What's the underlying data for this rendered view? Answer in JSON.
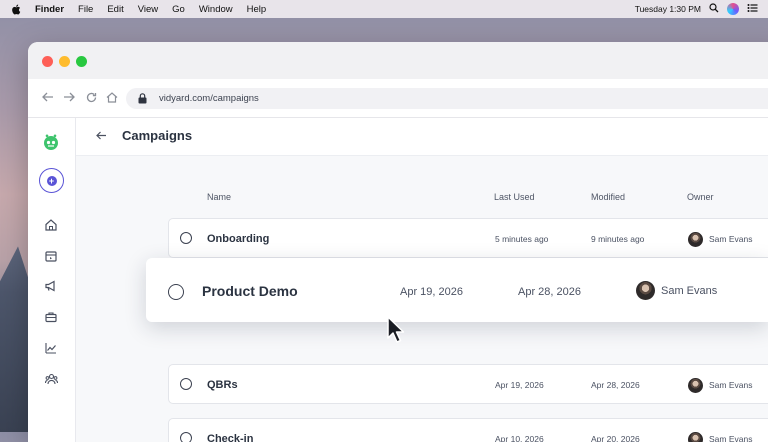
{
  "menubar": {
    "app": "Finder",
    "items": [
      "File",
      "Edit",
      "View",
      "Go",
      "Window",
      "Help"
    ],
    "clock": "Tuesday 1:30 PM"
  },
  "browser": {
    "url": "vidyard.com/campaigns"
  },
  "page": {
    "title": "Campaigns"
  },
  "table": {
    "columns": {
      "name": "Name",
      "last_used": "Last Used",
      "modified": "Modified",
      "owner": "Owner"
    },
    "rows": [
      {
        "name": "Onboarding",
        "last_used": "5 minutes ago",
        "modified": "9 minutes ago",
        "owner": "Sam Evans"
      },
      {
        "name": "QBRs",
        "last_used": "Apr 19, 2026",
        "modified": "Apr 28, 2026",
        "owner": "Sam Evans"
      },
      {
        "name": "Check-in",
        "last_used": "Apr 10, 2026",
        "modified": "Apr 20, 2026",
        "owner": "Sam Evans"
      }
    ],
    "dragging": {
      "name": "Product Demo",
      "last_used": "Apr 19, 2026",
      "modified": "Apr 28, 2026",
      "owner": "Sam Evans"
    }
  },
  "colors": {
    "accent": "#5a54d6",
    "brand_green": "#3ec46d"
  }
}
